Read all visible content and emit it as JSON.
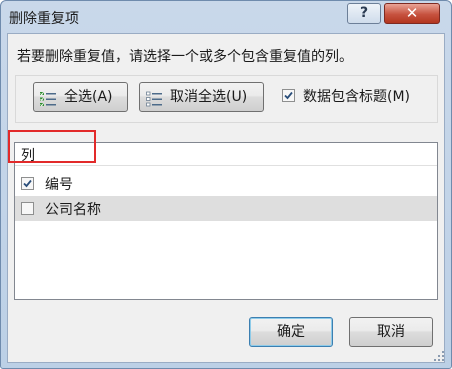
{
  "window": {
    "title": "删除重复项",
    "help_label": "?",
    "close_label": "✕"
  },
  "instruction": "若要删除重复值，请选择一个或多个包含重复值的列。",
  "toolbar": {
    "select_all_label": "全选(A)",
    "unselect_all_label": "取消全选(U)",
    "header_checkbox_label": "数据包含标题(M)",
    "header_checkbox_checked": true
  },
  "columns": {
    "header": "列",
    "items": [
      {
        "label": "编号",
        "checked": true
      },
      {
        "label": "公司名称",
        "checked": false
      }
    ]
  },
  "footer": {
    "ok_label": "确定",
    "cancel_label": "取消"
  },
  "colors": {
    "highlight": "#e22a2a",
    "selected_row": "#dedede"
  }
}
